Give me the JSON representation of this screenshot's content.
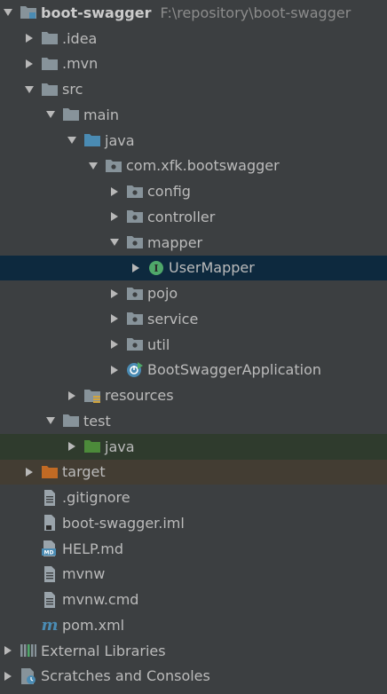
{
  "project": {
    "name": "boot-swagger",
    "path": "F:\\repository\\boot-swagger"
  },
  "tree": {
    "idea": ".idea",
    "mvn": ".mvn",
    "src": "src",
    "main": "main",
    "java_main": "java",
    "package": "com.xfk.bootswagger",
    "config": "config",
    "controller": "controller",
    "mapper": "mapper",
    "user_mapper": "UserMapper",
    "pojo": "pojo",
    "service": "service",
    "util": "util",
    "app": "BootSwaggerApplication",
    "resources": "resources",
    "test": "test",
    "java_test": "java",
    "target": "target",
    "gitignore": ".gitignore",
    "iml": "boot-swagger.iml",
    "help": "HELP.md",
    "mvnw": "mvnw",
    "mvnw_cmd": "mvnw.cmd",
    "pom": "pom.xml",
    "external_libraries": "External Libraries",
    "scratches": "Scratches and Consoles"
  },
  "colors": {
    "background": "#3c3f41",
    "selection": "#0d293e",
    "test_root_bg": "#2f3b2d",
    "excluded_bg": "#433d33",
    "folder": "#87939a",
    "source_folder": "#4a8bb3",
    "test_folder": "#4c8a3a",
    "excluded_folder": "#c16a24",
    "interface_icon": "#4fa86a"
  }
}
